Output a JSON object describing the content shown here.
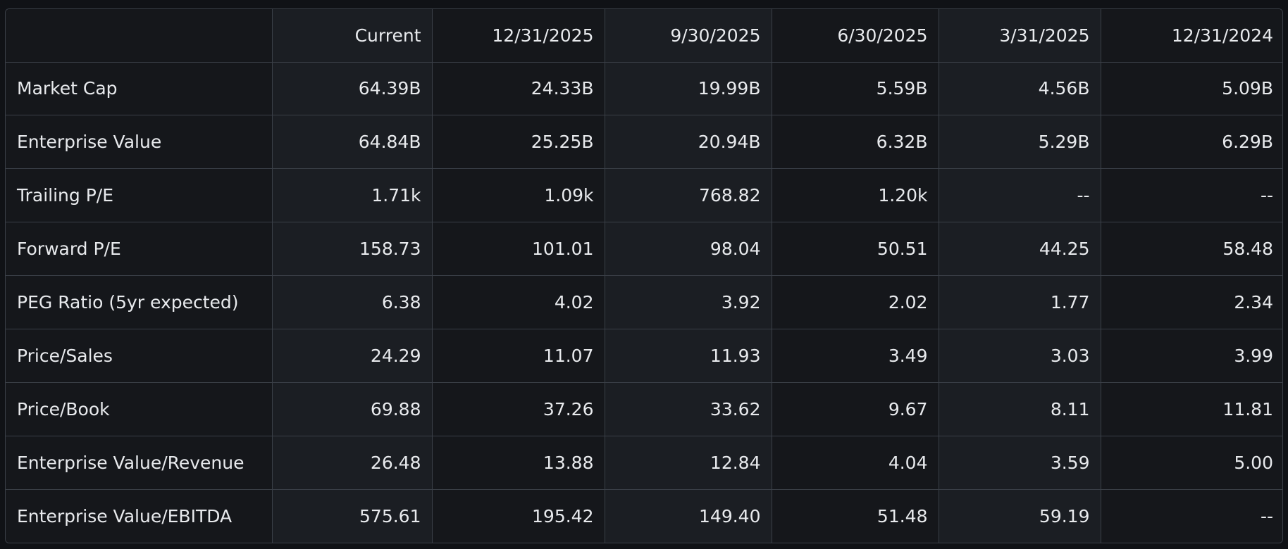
{
  "table": {
    "columns": [
      "",
      "Current",
      "12/31/2025",
      "9/30/2025",
      "6/30/2025",
      "3/31/2025",
      "12/31/2024"
    ],
    "rows": [
      {
        "label": "Market Cap",
        "values": [
          "64.39B",
          "24.33B",
          "19.99B",
          "5.59B",
          "4.56B",
          "5.09B"
        ]
      },
      {
        "label": "Enterprise Value",
        "values": [
          "64.84B",
          "25.25B",
          "20.94B",
          "6.32B",
          "5.29B",
          "6.29B"
        ]
      },
      {
        "label": "Trailing P/E",
        "values": [
          "1.71k",
          "1.09k",
          "768.82",
          "1.20k",
          "--",
          "--"
        ]
      },
      {
        "label": "Forward P/E",
        "values": [
          "158.73",
          "101.01",
          "98.04",
          "50.51",
          "44.25",
          "58.48"
        ]
      },
      {
        "label": "PEG Ratio (5yr expected)",
        "values": [
          "6.38",
          "4.02",
          "3.92",
          "2.02",
          "1.77",
          "2.34"
        ]
      },
      {
        "label": "Price/Sales",
        "values": [
          "24.29",
          "11.07",
          "11.93",
          "3.49",
          "3.03",
          "3.99"
        ]
      },
      {
        "label": "Price/Book",
        "values": [
          "69.88",
          "37.26",
          "33.62",
          "9.67",
          "8.11",
          "11.81"
        ]
      },
      {
        "label": "Enterprise Value/Revenue",
        "values": [
          "26.48",
          "13.88",
          "12.84",
          "4.04",
          "3.59",
          "5.00"
        ]
      },
      {
        "label": "Enterprise Value/EBITDA",
        "values": [
          "575.61",
          "195.42",
          "149.40",
          "51.48",
          "59.19",
          "--"
        ]
      }
    ]
  },
  "colors": {
    "background": "#101216",
    "text": "#e8eaed",
    "border": "#3a3f47"
  }
}
